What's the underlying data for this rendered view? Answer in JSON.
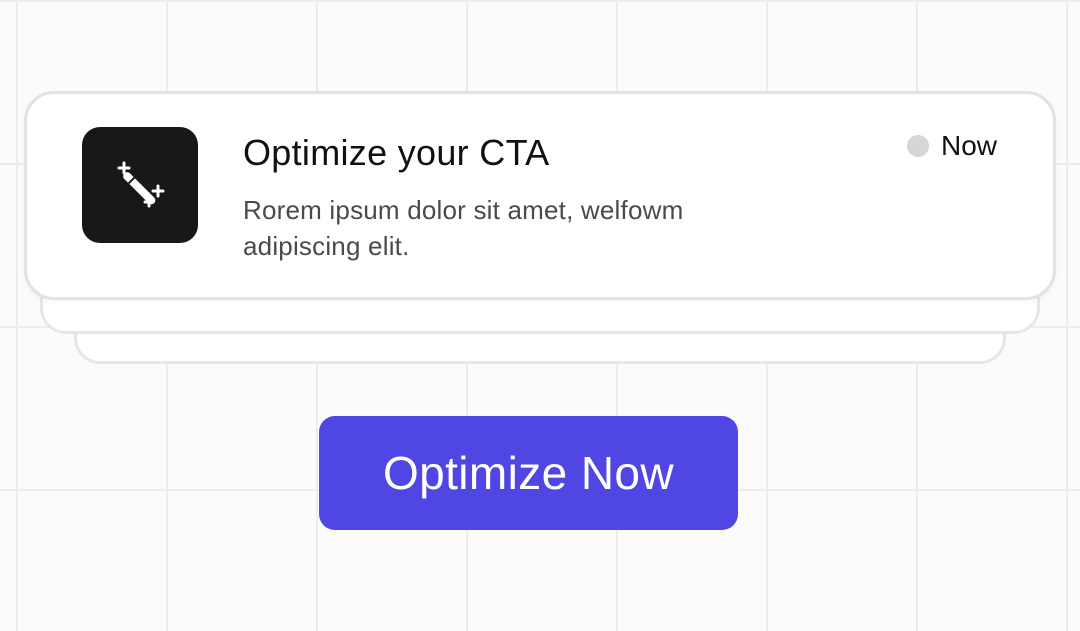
{
  "notification": {
    "icon": "magic-wand-icon",
    "title": "Optimize your CTA",
    "description": "Rorem ipsum dolor sit amet, welfowm adipiscing elit.",
    "status_label": "Now"
  },
  "cta": {
    "label": "Optimize Now"
  },
  "colors": {
    "accent": "#5046e4",
    "icon_bg": "#18181b",
    "status_dot": "#d6d6d6"
  }
}
